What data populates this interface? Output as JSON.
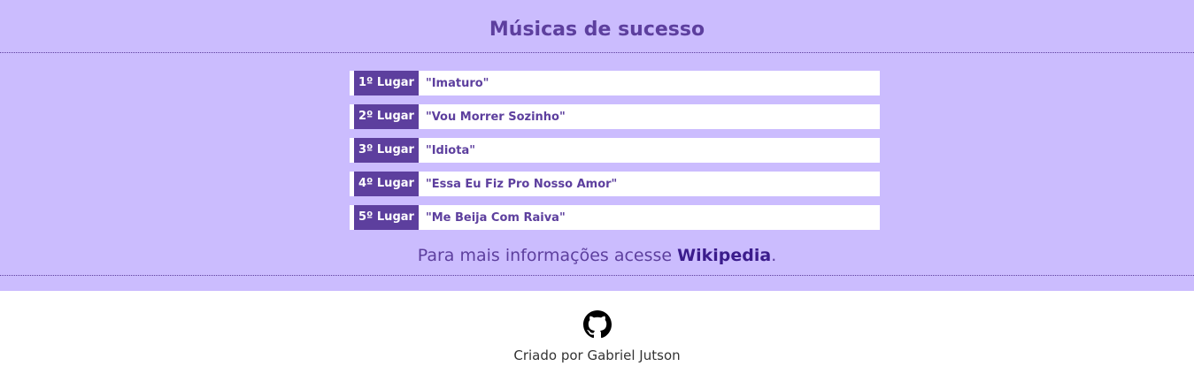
{
  "header": {
    "title": "Músicas de sucesso"
  },
  "songs": [
    {
      "rank": "1º Lugar",
      "title": "\"Imaturo\""
    },
    {
      "rank": "2º Lugar",
      "title": "\"Vou Morrer Sozinho\""
    },
    {
      "rank": "3º Lugar",
      "title": "\"Idiota\""
    },
    {
      "rank": "4º Lugar",
      "title": "\"Essa Eu Fiz Pro Nosso Amor\""
    },
    {
      "rank": "5º Lugar",
      "title": "\"Me Beija Com Raiva\""
    }
  ],
  "info": {
    "prefix": "Para mais informações acesse ",
    "link_label": "Wikipedia",
    "suffix": "."
  },
  "footer": {
    "icon": "github-icon",
    "credit": "Criado por Gabriel Jutson"
  },
  "colors": {
    "background": "#cbbcfe",
    "accent": "#5d3f9e",
    "link": "#3b1c8c"
  }
}
